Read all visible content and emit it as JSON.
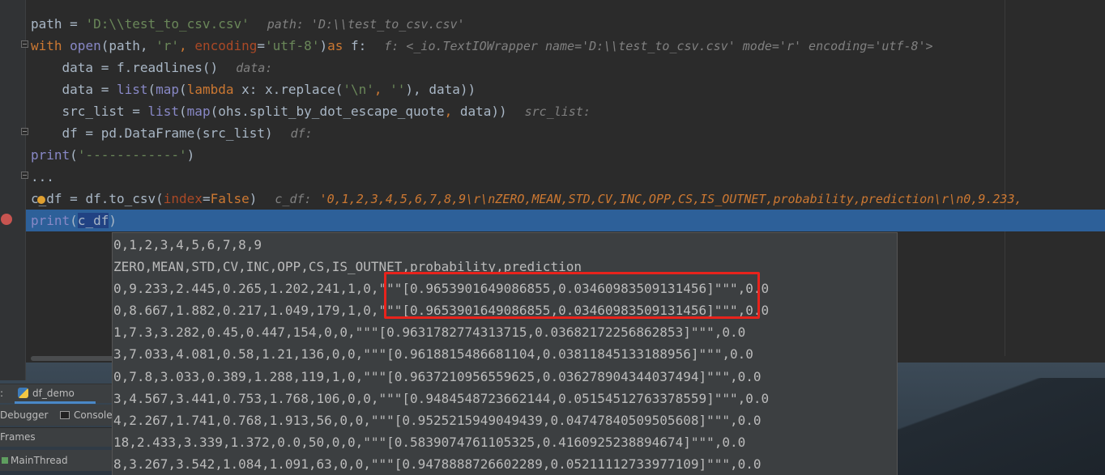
{
  "editor": {
    "lines": [
      {
        "code": [
          {
            "t": "path = ",
            "c": "plain"
          },
          {
            "t": "'D:\\\\test_to_csv.csv'",
            "c": "str"
          }
        ],
        "hint": "path: 'D:\\\\test_to_csv.csv'"
      },
      {
        "code": [
          {
            "t": "with ",
            "c": "kw"
          },
          {
            "t": "open",
            "c": "bi"
          },
          {
            "t": "(path, ",
            "c": "plain"
          },
          {
            "t": "'r'",
            "c": "str"
          },
          {
            "t": ", ",
            "c": "kw"
          },
          {
            "t": "encoding",
            "c": "param"
          },
          {
            "t": "=",
            "c": "plain"
          },
          {
            "t": "'utf-8'",
            "c": "str"
          },
          {
            "t": ")",
            "c": "plain"
          },
          {
            "t": "as ",
            "c": "kw"
          },
          {
            "t": "f:",
            "c": "plain"
          }
        ],
        "hint": "f: <_io.TextIOWrapper name='D:\\\\test_to_csv.csv' mode='r' encoding='utf-8'>"
      },
      {
        "code": [
          {
            "t": "    data = f.readlines()",
            "c": "plain"
          }
        ],
        "hint": "data:"
      },
      {
        "code": [
          {
            "t": "    data = ",
            "c": "plain"
          },
          {
            "t": "list",
            "c": "bi"
          },
          {
            "t": "(",
            "c": "plain"
          },
          {
            "t": "map",
            "c": "bi"
          },
          {
            "t": "(",
            "c": "plain"
          },
          {
            "t": "lambda ",
            "c": "kw"
          },
          {
            "t": "x: x.replace(",
            "c": "plain"
          },
          {
            "t": "'\\n'",
            "c": "str"
          },
          {
            "t": ", ",
            "c": "kw"
          },
          {
            "t": "''",
            "c": "str"
          },
          {
            "t": "), data))",
            "c": "plain"
          }
        ],
        "hint": ""
      },
      {
        "code": [
          {
            "t": "    src_list = ",
            "c": "plain"
          },
          {
            "t": "list",
            "c": "bi"
          },
          {
            "t": "(",
            "c": "plain"
          },
          {
            "t": "map",
            "c": "bi"
          },
          {
            "t": "(ohs.split_by_dot_escape_quote",
            "c": "plain"
          },
          {
            "t": ", ",
            "c": "kw"
          },
          {
            "t": "data))",
            "c": "plain"
          }
        ],
        "hint": "src_list:"
      },
      {
        "code": [
          {
            "t": "    df = pd.DataFrame(src_list)",
            "c": "plain"
          }
        ],
        "hint": "df:"
      },
      {
        "code": [
          {
            "t": "print",
            "c": "bi"
          },
          {
            "t": "(",
            "c": "plain"
          },
          {
            "t": "'------------'",
            "c": "str"
          },
          {
            "t": ")",
            "c": "plain"
          }
        ],
        "hint": ""
      },
      {
        "code": [
          {
            "t": "...",
            "c": "plain"
          }
        ],
        "hint": ""
      },
      {
        "code": [
          {
            "t": "c",
            "c": "plain"
          },
          {
            "t": "_df = df.to_csv(",
            "c": "plain"
          },
          {
            "t": "index",
            "c": "param"
          },
          {
            "t": "=",
            "c": "plain"
          },
          {
            "t": "False",
            "c": "kw"
          },
          {
            "t": ")",
            "c": "plain"
          }
        ],
        "hint": "c_df:",
        "hint_value": "'0,1,2,3,4,5,6,7,8,9\\r\\nZERO,MEAN,STD,CV,INC,OPP,CS,IS_OUTNET,probability,prediction\\r\\n0,9.233,"
      },
      {
        "code": [
          {
            "t": "print",
            "c": "bi"
          },
          {
            "t": "(",
            "c": "plain"
          },
          {
            "t": "c_df",
            "c": "sel"
          },
          {
            "t": ")",
            "c": "plain"
          }
        ],
        "hint": "",
        "current": true
      }
    ]
  },
  "popup": {
    "lines": [
      "0,1,2,3,4,5,6,7,8,9",
      "ZERO,MEAN,STD,CV,INC,OPP,CS,IS_OUTNET,probability,prediction",
      "0,9.233,2.445,0.265,1.202,241,1,0,\"\"\"[0.9653901649086855,0.03460983509131456]\"\"\",0.0",
      "0,8.667,1.882,0.217,1.049,179,1,0,\"\"\"[0.9653901649086855,0.03460983509131456]\"\"\",0.0",
      "1,7.3,3.282,0.45,0.447,154,0,0,\"\"\"[0.9631782774313715,0.03682172256862853]\"\"\",0.0",
      "3,7.033,4.081,0.58,1.21,136,0,0,\"\"\"[0.9618815486681104,0.03811845133188956]\"\"\",0.0",
      "0,7.8,3.033,0.389,1.288,119,1,0,\"\"\"[0.9637210956559625,0.036278904344037494]\"\"\",0.0",
      "3,4.567,3.441,0.753,1.768,106,0,0,\"\"\"[0.9484548723662144,0.05154512763378559]\"\"\",0.0",
      "4,2.267,1.741,0.768,1.913,56,0,0,\"\"\"[0.9525215949049439,0.04747840509505608]\"\"\",0.0",
      "18,2.433,3.339,1.372,0.0,50,0,0,\"\"\"[0.5839074761105325,0.4160925238894674]\"\"\",0.0",
      "8,3.267,3.542,1.084,1.091,63,0,0,\"\"\"[0.9478888726602289,0.05211112733977109]\"\"\",0.0"
    ]
  },
  "debug_panel": {
    "tab_prefix": ":",
    "tab_label": "df_demo",
    "debugger_label": "Debugger",
    "console_label": "Console",
    "frames_label": "Frames",
    "thread_label": "MainThread"
  },
  "colors": {
    "editor_bg": "#2b2b2b",
    "current_line": "#2d6099",
    "keyword": "#cc7832",
    "string": "#6a8759",
    "builtin": "#8888c6",
    "highlight_box": "#e8231c"
  }
}
